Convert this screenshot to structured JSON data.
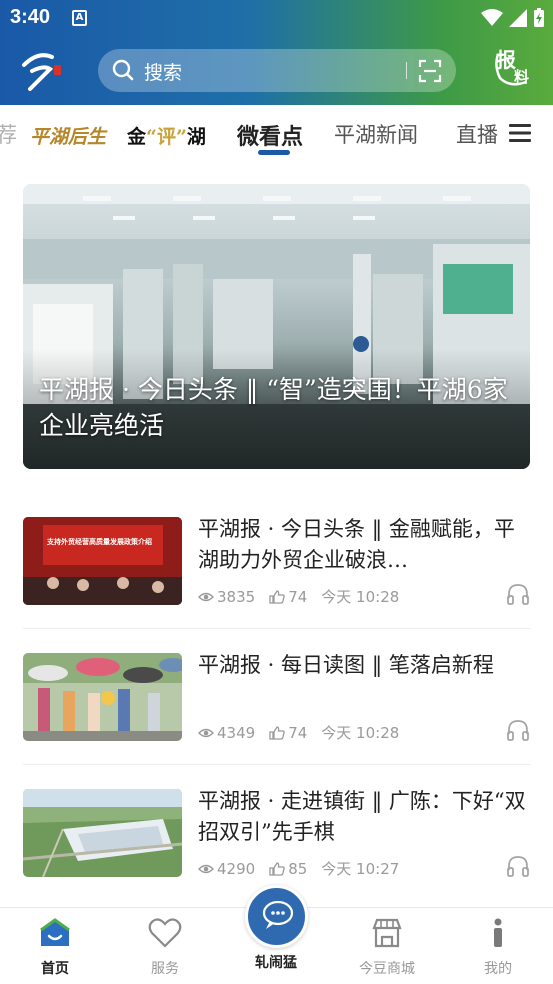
{
  "status_bar": {
    "time": "3:40",
    "app_badge": "A"
  },
  "header": {
    "search_placeholder": "搜索",
    "report_label_top": "报",
    "report_label_bottom": "料"
  },
  "tabs": [
    {
      "label": "荐"
    },
    {
      "label": "平湖后生"
    },
    {
      "label_pre": "金",
      "label_quote": "“评”",
      "label_post": "湖"
    },
    {
      "label": "微看点",
      "active": true
    },
    {
      "label": "平湖新闻"
    },
    {
      "label": "直播"
    }
  ],
  "hero": {
    "caption": "平湖报 · 今日头条 ‖ “智”造突围！平湖6家企业亮绝活"
  },
  "news": [
    {
      "title": "平湖报 · 今日头条 ‖ 金融赋能，平湖助力外贸企业破浪…",
      "views": "3835",
      "likes": "74",
      "time": "今天  10:28",
      "thumb_banner": "支持外贸经营高质量发展政策介绍"
    },
    {
      "title": "平湖报 · 每日读图 ‖ 笔落启新程",
      "views": "4349",
      "likes": "74",
      "time": "今天  10:28"
    },
    {
      "title": "平湖报 · 走进镇街 ‖ 广陈：下好“双招双引”先手棋",
      "views": "4290",
      "likes": "85",
      "time": "今天  10:27"
    }
  ],
  "bottom_nav": [
    {
      "label": "首页",
      "active": true
    },
    {
      "label": "服务"
    },
    {
      "label": "轧闹猛"
    },
    {
      "label": "今豆商城"
    },
    {
      "label": "我的"
    }
  ],
  "colors": {
    "brand_blue": "#1d5aa6",
    "brand_green": "#5aab3d",
    "brand_gold": "#b5862a"
  }
}
